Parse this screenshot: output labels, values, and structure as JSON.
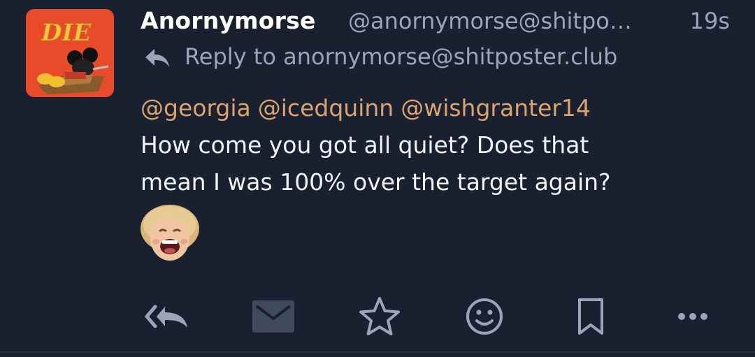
{
  "status": {
    "display_name": "Anornymorse",
    "handle": "@anornymorse@shitpo…",
    "timestamp": "19s",
    "reply_to": "Reply to anornymorse@shitposter.club",
    "mentions": [
      "@georgia",
      "@icedquinn",
      "@wishgranter14"
    ],
    "text_line1": "How come you got all quiet? Does that",
    "text_line2": "mean I was 100% over the target again?"
  },
  "avatar": {
    "icon": "die-mousetrap-avatar",
    "logo_text": "DIE",
    "background": "#e84a2a"
  },
  "emoji": {
    "icon": "laughing-face-emoji"
  },
  "actions": [
    {
      "name": "reply-all-icon"
    },
    {
      "name": "envelope-icon"
    },
    {
      "name": "star-icon"
    },
    {
      "name": "smiley-icon"
    },
    {
      "name": "bookmark-icon"
    },
    {
      "name": "more-icon"
    }
  ],
  "colors": {
    "background": "#192130",
    "mention": "#dca36e",
    "muted": "#9aa5b8",
    "text": "#f2f4f8"
  }
}
